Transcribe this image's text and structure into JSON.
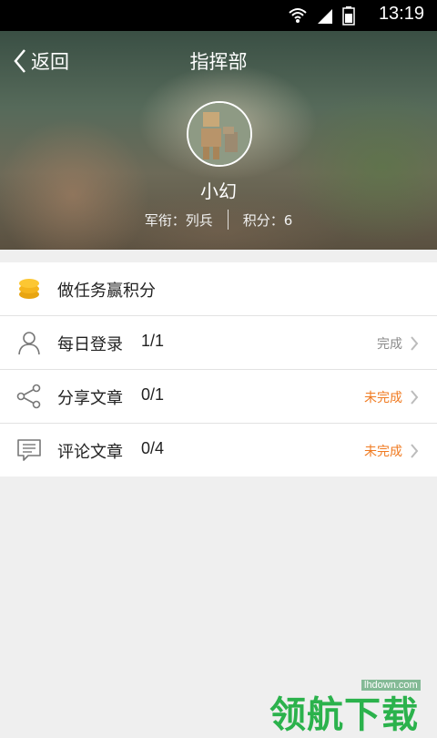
{
  "status_bar": {
    "time": "13:19"
  },
  "header": {
    "back_label": "返回",
    "title": "指挥部",
    "username": "小幻",
    "rank": "军衔：列兵",
    "points": "积分：6"
  },
  "tasks": {
    "section_title": "做任务赢积分",
    "items": [
      {
        "name": "每日登录",
        "progress": "1/1",
        "status": "完成",
        "icon": "user-icon"
      },
      {
        "name": "分享文章",
        "progress": "0/1",
        "status": "未完成",
        "icon": "share-icon"
      },
      {
        "name": "评论文章",
        "progress": "0/4",
        "status": "未完成",
        "icon": "comment-icon"
      }
    ]
  },
  "colors": {
    "undone": "#f07a20",
    "done": "#8a8a8a",
    "coin": "#f5b51d"
  },
  "watermark": {
    "url": "lhdown.com",
    "logo": "领航下载"
  }
}
